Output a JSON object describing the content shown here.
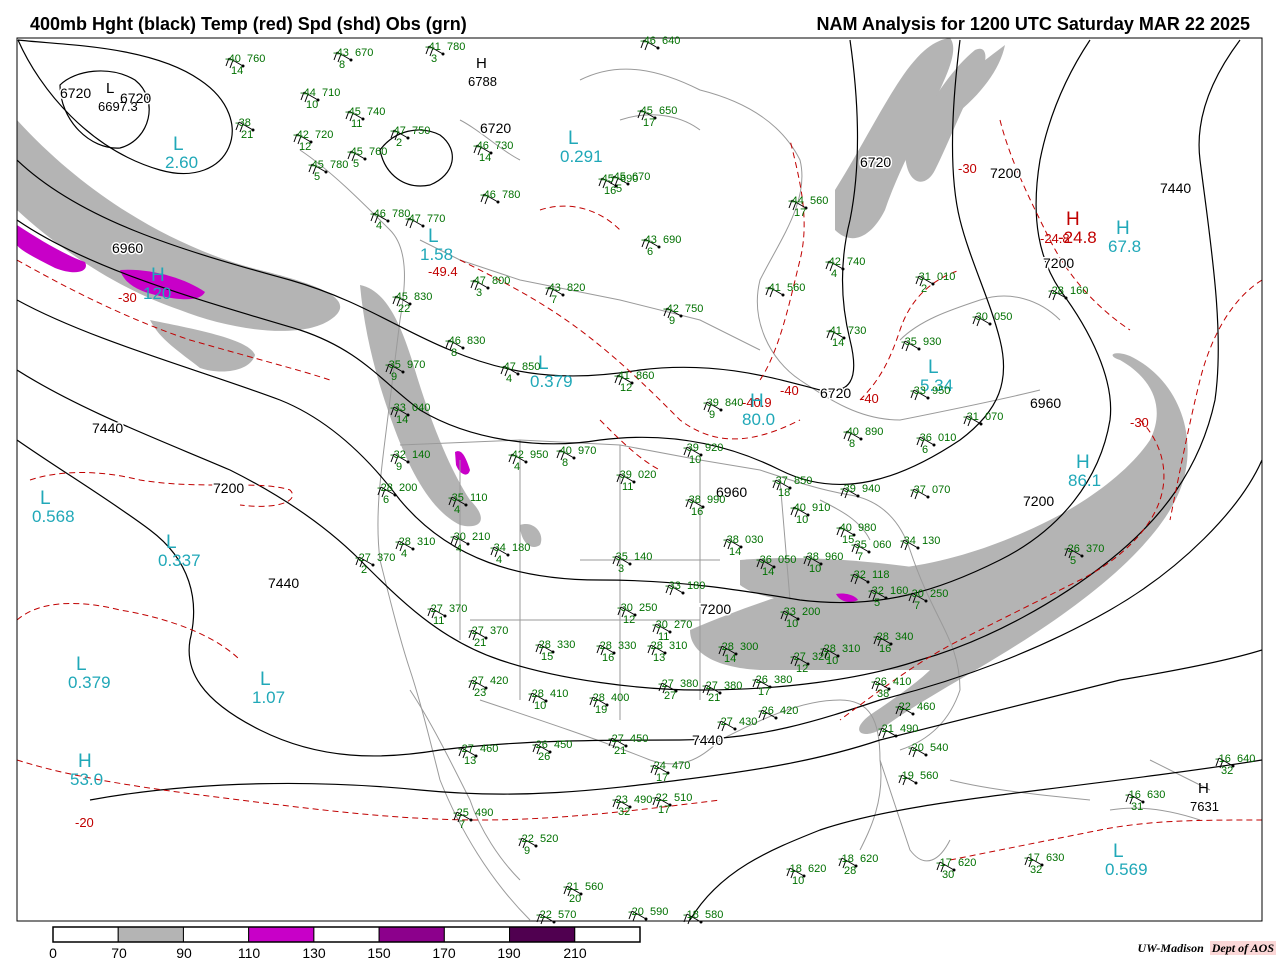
{
  "header": {
    "title_left": "400mb Hght (black) Temp (red) Spd (shd) Obs (grn)",
    "title_right": "NAM Analysis for 1200 UTC Saturday  MAR 22 2025"
  },
  "colors": {
    "height_contour": "#000000",
    "temp_contour": "#c00000",
    "obs_text": "#007000",
    "center_cyan": "#20a8b8",
    "speed_70_90": "#b4b4b4",
    "speed_110_130": "#c800c8",
    "speed_150_170": "#8c008c",
    "speed_190_210": "#500050",
    "borders": "#9a9a9a"
  },
  "height_labels": [
    "6720",
    "6720",
    "6720",
    "6720",
    "6720",
    "6960",
    "6960",
    "6960",
    "7200",
    "7200",
    "7200",
    "7200",
    "7200",
    "7440",
    "7440",
    "7440",
    "7440"
  ],
  "temp_labels": [
    "-30",
    "-30",
    "-30",
    "-40",
    "-40",
    "-20",
    "-40.9",
    "-24.8",
    "-49.4"
  ],
  "pressure_centers": [
    {
      "letter": "L",
      "value": "6697.3",
      "kind": "height"
    },
    {
      "letter": "H",
      "value": "6788",
      "kind": "height"
    },
    {
      "letter": "H",
      "value": "7631",
      "kind": "height"
    },
    {
      "letter": "L",
      "value": "2.60",
      "kind": "speed"
    },
    {
      "letter": "L",
      "value": "0.291",
      "kind": "speed"
    },
    {
      "letter": "L",
      "value": "1.58",
      "kind": "speed"
    },
    {
      "letter": "L",
      "value": "0.379",
      "kind": "speed"
    },
    {
      "letter": "L",
      "value": "0.568",
      "kind": "speed"
    },
    {
      "letter": "L",
      "value": "0.337",
      "kind": "speed"
    },
    {
      "letter": "L",
      "value": "0.379",
      "kind": "speed"
    },
    {
      "letter": "L",
      "value": "1.07",
      "kind": "speed"
    },
    {
      "letter": "H",
      "value": "53.0",
      "kind": "speed"
    },
    {
      "letter": "H",
      "value": "67.8",
      "kind": "speed"
    },
    {
      "letter": "H",
      "value": "86.1",
      "kind": "speed"
    },
    {
      "letter": "H",
      "value": "80.0",
      "kind": "speed"
    },
    {
      "letter": "H",
      "value": "120",
      "kind": "speed"
    },
    {
      "letter": "L",
      "value": "0.569",
      "kind": "speed"
    },
    {
      "letter": "L",
      "value": "5.34",
      "kind": "speed"
    },
    {
      "letter": "H",
      "value": "-24.8",
      "kind": "temp"
    }
  ],
  "observations": [
    {
      "temp": "-40",
      "hgt": "760",
      "spd": "14"
    },
    {
      "temp": "-38",
      "hgt": "",
      "spd": "21"
    },
    {
      "temp": "-43",
      "hgt": "670",
      "spd": "8"
    },
    {
      "temp": "-41",
      "hgt": "780",
      "spd": "3"
    },
    {
      "temp": "-44",
      "hgt": "710",
      "spd": "10"
    },
    {
      "temp": "-45",
      "hgt": "740",
      "spd": "11"
    },
    {
      "temp": "-42",
      "hgt": "720",
      "spd": "12"
    },
    {
      "temp": "-47",
      "hgt": "750",
      "spd": "2"
    },
    {
      "temp": "-45",
      "hgt": "760",
      "spd": "5"
    },
    {
      "temp": "-46",
      "hgt": "730",
      "spd": "14"
    },
    {
      "temp": "-45",
      "hgt": "780",
      "spd": "5"
    },
    {
      "temp": "-45",
      "hgt": "650",
      "spd": "17"
    },
    {
      "temp": "-45",
      "hgt": "670",
      "spd": "5"
    },
    {
      "temp": "-46",
      "hgt": "780",
      "spd": "4"
    },
    {
      "temp": "-47",
      "hgt": "770",
      "spd": ""
    },
    {
      "temp": "-46",
      "hgt": "780",
      "spd": ""
    },
    {
      "temp": "-45",
      "hgt": "690",
      "spd": "16"
    },
    {
      "temp": "-44",
      "hgt": "560",
      "spd": "17"
    },
    {
      "temp": "-43",
      "hgt": "690",
      "spd": "6"
    },
    {
      "temp": "-47",
      "hgt": "800",
      "spd": "3"
    },
    {
      "temp": "-43",
      "hgt": "820",
      "spd": "7"
    },
    {
      "temp": "-42",
      "hgt": "740",
      "spd": "4"
    },
    {
      "temp": "-41",
      "hgt": "560",
      "spd": ""
    },
    {
      "temp": "-31",
      "hgt": "010",
      "spd": "2"
    },
    {
      "temp": "-28",
      "hgt": "160",
      "spd": ""
    },
    {
      "temp": "-42",
      "hgt": "750",
      "spd": "9"
    },
    {
      "temp": "-45",
      "hgt": "830",
      "spd": "22"
    },
    {
      "temp": "-46",
      "hgt": "830",
      "spd": "8"
    },
    {
      "temp": "-41",
      "hgt": "730",
      "spd": "14"
    },
    {
      "temp": "-30",
      "hgt": "050",
      "spd": ""
    },
    {
      "temp": "-35",
      "hgt": "930",
      "spd": ""
    },
    {
      "temp": "-35",
      "hgt": "970",
      "spd": "9"
    },
    {
      "temp": "-47",
      "hgt": "850",
      "spd": "4"
    },
    {
      "temp": "-41",
      "hgt": "860",
      "spd": "12"
    },
    {
      "temp": "-33",
      "hgt": "950",
      "spd": ""
    },
    {
      "temp": "-33",
      "hgt": "040",
      "spd": "14"
    },
    {
      "temp": "-39",
      "hgt": "840",
      "spd": "9"
    },
    {
      "temp": "-40",
      "hgt": "890",
      "spd": "8"
    },
    {
      "temp": "-36",
      "hgt": "010",
      "spd": "6"
    },
    {
      "temp": "-31",
      "hgt": "070",
      "spd": ""
    },
    {
      "temp": "-32",
      "hgt": "140",
      "spd": "9"
    },
    {
      "temp": "-42",
      "hgt": "950",
      "spd": "4"
    },
    {
      "temp": "-40",
      "hgt": "970",
      "spd": "8"
    },
    {
      "temp": "-39",
      "hgt": "920",
      "spd": "10"
    },
    {
      "temp": "-39",
      "hgt": "020",
      "spd": "11"
    },
    {
      "temp": "-37",
      "hgt": "850",
      "spd": "18"
    },
    {
      "temp": "-39",
      "hgt": "940",
      "spd": ""
    },
    {
      "temp": "-37",
      "hgt": "070",
      "spd": ""
    },
    {
      "temp": "-28",
      "hgt": "200",
      "spd": "6"
    },
    {
      "temp": "-35",
      "hgt": "110",
      "spd": "4"
    },
    {
      "temp": "-38",
      "hgt": "990",
      "spd": "16"
    },
    {
      "temp": "-40",
      "hgt": "910",
      "spd": "10"
    },
    {
      "temp": "-40",
      "hgt": "980",
      "spd": "15"
    },
    {
      "temp": "-28",
      "hgt": "310",
      "spd": "4"
    },
    {
      "temp": "-30",
      "hgt": "210",
      "spd": "4"
    },
    {
      "temp": "-34",
      "hgt": "180",
      "spd": "4"
    },
    {
      "temp": "-38",
      "hgt": "030",
      "spd": "14"
    },
    {
      "temp": "-36",
      "hgt": "050",
      "spd": "14"
    },
    {
      "temp": "-38",
      "hgt": "960",
      "spd": "10"
    },
    {
      "temp": "-35",
      "hgt": "060",
      "spd": "7"
    },
    {
      "temp": "-34",
      "hgt": "130",
      "spd": ""
    },
    {
      "temp": "-27",
      "hgt": "370",
      "spd": "2"
    },
    {
      "temp": "-35",
      "hgt": "140",
      "spd": "3"
    },
    {
      "temp": "-33",
      "hgt": "180",
      "spd": ""
    },
    {
      "temp": "-32",
      "hgt": "118",
      "spd": ""
    },
    {
      "temp": "-32",
      "hgt": "160",
      "spd": "5"
    },
    {
      "temp": "-30",
      "hgt": "250",
      "spd": "7"
    },
    {
      "temp": "-26",
      "hgt": "370",
      "spd": "5"
    },
    {
      "temp": "-27",
      "hgt": "370",
      "spd": "11"
    },
    {
      "temp": "-30",
      "hgt": "250",
      "spd": "12"
    },
    {
      "temp": "-33",
      "hgt": "200",
      "spd": "10"
    },
    {
      "temp": "-27",
      "hgt": "370",
      "spd": "21"
    },
    {
      "temp": "-30",
      "hgt": "270",
      "spd": "11"
    },
    {
      "temp": "-28",
      "hgt": "330",
      "spd": "15"
    },
    {
      "temp": "-28",
      "hgt": "330",
      "spd": "16"
    },
    {
      "temp": "-28",
      "hgt": "310",
      "spd": "13"
    },
    {
      "temp": "-28",
      "hgt": "300",
      "spd": "14"
    },
    {
      "temp": "-27",
      "hgt": "320",
      "spd": "12"
    },
    {
      "temp": "-28",
      "hgt": "310",
      "spd": "10"
    },
    {
      "temp": "-28",
      "hgt": "340",
      "spd": "16"
    },
    {
      "temp": "-27",
      "hgt": "420",
      "spd": "23"
    },
    {
      "temp": "-28",
      "hgt": "410",
      "spd": "10"
    },
    {
      "temp": "-28",
      "hgt": "400",
      "spd": "19"
    },
    {
      "temp": "-27",
      "hgt": "380",
      "spd": "27"
    },
    {
      "temp": "-27",
      "hgt": "380",
      "spd": "21"
    },
    {
      "temp": "-26",
      "hgt": "380",
      "spd": "17"
    },
    {
      "temp": "-26",
      "hgt": "410",
      "spd": "38"
    },
    {
      "temp": "-27",
      "hgt": "430",
      "spd": ""
    },
    {
      "temp": "-26",
      "hgt": "420",
      "spd": ""
    },
    {
      "temp": "-22",
      "hgt": "460",
      "spd": ""
    },
    {
      "temp": "-21",
      "hgt": "490",
      "spd": ""
    },
    {
      "temp": "-27",
      "hgt": "460",
      "spd": "13"
    },
    {
      "temp": "-26",
      "hgt": "450",
      "spd": "26"
    },
    {
      "temp": "-27",
      "hgt": "450",
      "spd": "21"
    },
    {
      "temp": "-20",
      "hgt": "540",
      "spd": ""
    },
    {
      "temp": "-19",
      "hgt": "560",
      "spd": ""
    },
    {
      "temp": "-24",
      "hgt": "470",
      "spd": "17"
    },
    {
      "temp": "-23",
      "hgt": "490",
      "spd": "32"
    },
    {
      "temp": "-22",
      "hgt": "510",
      "spd": "17"
    },
    {
      "temp": "-25",
      "hgt": "490",
      "spd": "7"
    },
    {
      "temp": "-22",
      "hgt": "520",
      "spd": "9"
    },
    {
      "temp": "-21",
      "hgt": "560",
      "spd": "20"
    },
    {
      "temp": "-22",
      "hgt": "570",
      "spd": ""
    },
    {
      "temp": "-20",
      "hgt": "590",
      "spd": ""
    },
    {
      "temp": "-18",
      "hgt": "580",
      "spd": ""
    },
    {
      "temp": "-18",
      "hgt": "620",
      "spd": "10"
    },
    {
      "temp": "-18",
      "hgt": "620",
      "spd": "28"
    },
    {
      "temp": "-17",
      "hgt": "620",
      "spd": "30"
    },
    {
      "temp": "-17",
      "hgt": "630",
      "spd": "32"
    },
    {
      "temp": "-16",
      "hgt": "640",
      "spd": "32"
    },
    {
      "temp": "-16",
      "hgt": "630",
      "spd": "31"
    },
    {
      "temp": "-46",
      "hgt": "640",
      "spd": ""
    }
  ],
  "legend": {
    "colors": [
      "#ffffff",
      "#b4b4b4",
      "#ffffff",
      "#c800c8",
      "#ffffff",
      "#8c008c",
      "#ffffff",
      "#500050",
      "#ffffff"
    ],
    "ticks": [
      "0",
      "70",
      "90",
      "110",
      "130",
      "150",
      "170",
      "190",
      "210"
    ]
  },
  "credit": {
    "org": "UW-Madison",
    "dept": "Dept of AOS"
  }
}
